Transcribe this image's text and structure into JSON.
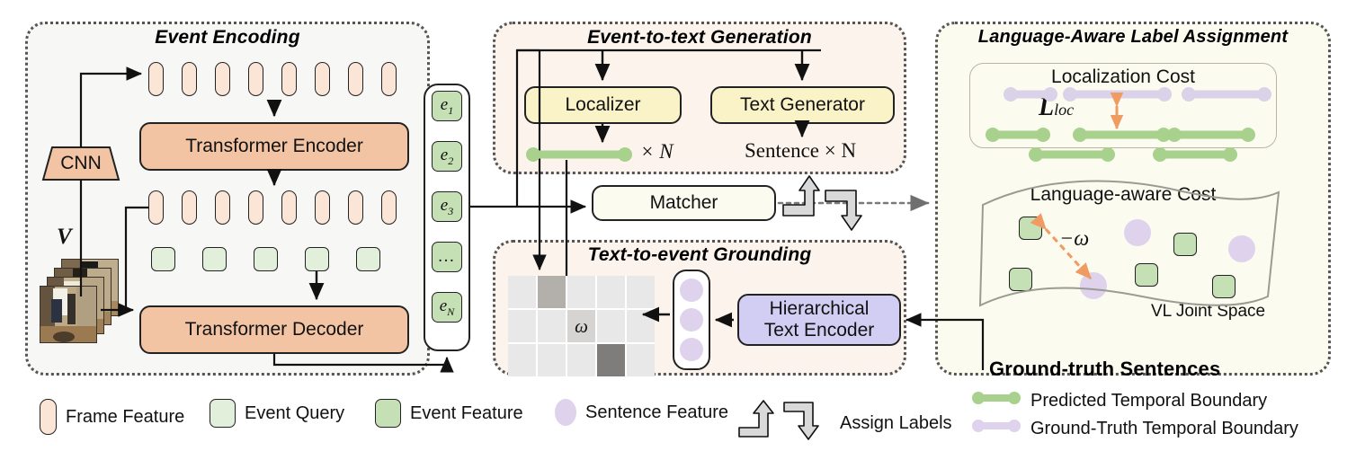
{
  "figure": {
    "type": "architecture-diagram",
    "panels": {
      "event_encoding": {
        "title": "Event Encoding",
        "cnn_label": "CNN",
        "video_label": "V",
        "encoder_label": "Transformer Encoder",
        "decoder_label": "Transformer Decoder",
        "frame_feature_count_row1": 8,
        "frame_feature_count_row2": 8,
        "event_query_count": 5
      },
      "event_column": {
        "items": [
          "e1",
          "e2",
          "e3",
          "...",
          "eN"
        ],
        "items_display": [
          {
            "base": "e",
            "sub": "1"
          },
          {
            "base": "e",
            "sub": "2"
          },
          {
            "base": "e",
            "sub": "3"
          },
          {
            "base": "…",
            "sub": ""
          },
          {
            "base": "e",
            "sub": "N"
          }
        ]
      },
      "event_to_text": {
        "title": "Event-to-text Generation",
        "localizer_label": "Localizer",
        "text_generator_label": "Text Generator",
        "localizer_output": "× N",
        "generator_output": "Sentence × N"
      },
      "matcher": {
        "label": "Matcher"
      },
      "text_to_event": {
        "title": "Text-to-event Grounding",
        "omega_label": "ω",
        "text_encoder_label": "Hierarchical\nText Encoder",
        "text_encoder_line1": "Hierarchical",
        "text_encoder_line2": "Text Encoder",
        "matrix_rows": 3,
        "matrix_cols": 5,
        "sentence_feature_count": 3
      },
      "label_assignment": {
        "title": "Language-Aware Label Assignment",
        "localization_cost_label": "Localization Cost",
        "loc_cost_symbol": "L",
        "loc_cost_subscript": "loc",
        "language_aware_cost_label": "Language-aware Cost",
        "omega_cost_label": "−ω",
        "joint_space_label": "VL Joint Space",
        "event_feature_count": 5,
        "sentence_feature_count": 3
      }
    },
    "ground_truth_sentences": "Ground-truth Sentences",
    "legend": [
      {
        "icon": "frame-feature-chip",
        "label": "Frame Feature"
      },
      {
        "icon": "event-query-chip",
        "label": "Event Query"
      },
      {
        "icon": "event-feature-chip",
        "label": "Event Feature"
      },
      {
        "icon": "sentence-feature-circle",
        "label": "Sentence Feature"
      },
      {
        "icon": "assign-labels-arrows",
        "label": "Assign Labels"
      },
      {
        "icon": "green-segment",
        "label": "Predicted Temporal Boundary"
      },
      {
        "icon": "purple-segment",
        "label": "Ground-Truth Temporal Boundary"
      }
    ],
    "colors": {
      "frame_feature": "#fbe5d6",
      "event_query": "#e2efda",
      "event_feature": "#c5e0b4",
      "sentence_feature": "#ded2ec",
      "transformer_block": "#f3c4a3",
      "localizer_block": "#faf3c8",
      "text_encoder_block": "#d2cdf2",
      "predicted_boundary": "#a9d18e",
      "groundtruth_boundary": "#d9d2e9",
      "cost_arrow": "#f0a070",
      "panel_encoding_bg": "#f7f7f5",
      "panel_generation_bg": "#fcf3ec",
      "panel_assignment_bg": "#fbfbef"
    }
  }
}
